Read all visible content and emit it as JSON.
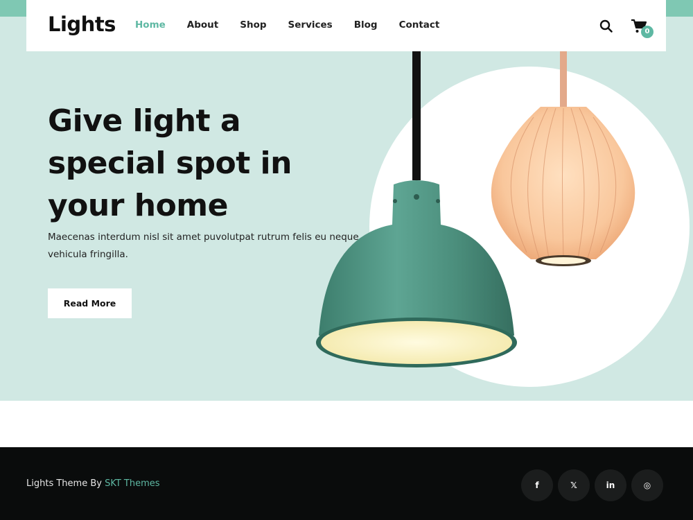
{
  "brand": {
    "logo": "Lights",
    "accent_color": "#5eb8a3",
    "hero_bg": "#d0e8e3"
  },
  "nav": {
    "items": [
      {
        "label": "Home",
        "active": true
      },
      {
        "label": "About",
        "active": false
      },
      {
        "label": "Shop",
        "active": false
      },
      {
        "label": "Services",
        "active": false
      },
      {
        "label": "Blog",
        "active": false
      },
      {
        "label": "Contact",
        "active": false
      }
    ],
    "search_icon": "search-icon",
    "cart_icon": "cart-icon",
    "cart_count": "0"
  },
  "hero": {
    "title_lines": [
      "Give light a",
      "special spot in",
      "your home"
    ],
    "description": "Maecenas interdum nisl sit amet puvolutpat rutrum felis eu neque vehicula fringilla.",
    "button_label": "Read More"
  },
  "footer": {
    "credit_prefix": "Lights Theme By ",
    "credit_link": "SKT Themes",
    "social": [
      {
        "icon": "facebook-icon",
        "glyph": "f"
      },
      {
        "icon": "x-icon",
        "glyph": "𝕏"
      },
      {
        "icon": "linkedin-icon",
        "glyph": "in"
      },
      {
        "icon": "instagram-icon",
        "glyph": "◎"
      }
    ]
  }
}
